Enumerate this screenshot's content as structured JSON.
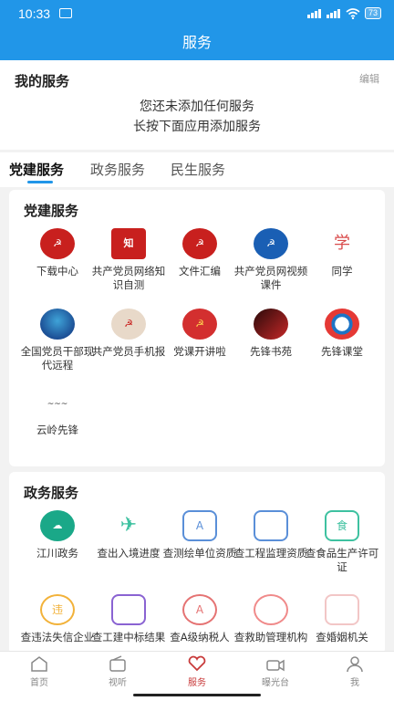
{
  "status": {
    "time": "10:33",
    "battery": "73"
  },
  "header": {
    "title": "服务"
  },
  "my_services": {
    "title": "我的服务",
    "edit": "编辑",
    "empty_line1": "您还未添加任何服务",
    "empty_line2": "长按下面应用添加服务"
  },
  "tabs": [
    {
      "label": "党建服务"
    },
    {
      "label": "政务服务"
    },
    {
      "label": "民生服务"
    }
  ],
  "party": {
    "title": "党建服务",
    "items": [
      {
        "label": "下载中心"
      },
      {
        "label": "共产党员网络知识自测"
      },
      {
        "label": "文件汇编"
      },
      {
        "label": "共产党员网视频课件"
      },
      {
        "label": "同学"
      },
      {
        "label": "全国党员干部现代远程"
      },
      {
        "label": "共产党员手机报"
      },
      {
        "label": "党课开讲啦"
      },
      {
        "label": "先锋书苑"
      },
      {
        "label": "先锋课堂"
      },
      {
        "label": "云岭先锋"
      }
    ]
  },
  "gov": {
    "title": "政务服务",
    "items": [
      {
        "label": "江川政务"
      },
      {
        "label": "查出入境进度"
      },
      {
        "label": "查测绘单位资质"
      },
      {
        "label": "查工程监理资质"
      },
      {
        "label": "查食品生产许可证"
      },
      {
        "label": "查违法失信企业"
      },
      {
        "label": "查工建中标结果"
      },
      {
        "label": "查A级纳税人"
      },
      {
        "label": "查救助管理机构"
      },
      {
        "label": "查婚姻机关"
      }
    ]
  },
  "nav": [
    {
      "label": "首页"
    },
    {
      "label": "视听"
    },
    {
      "label": "服务"
    },
    {
      "label": "曝光台"
    },
    {
      "label": "我"
    }
  ],
  "colors": {
    "primary": "#2196e8",
    "active_nav": "#c83a3a"
  }
}
